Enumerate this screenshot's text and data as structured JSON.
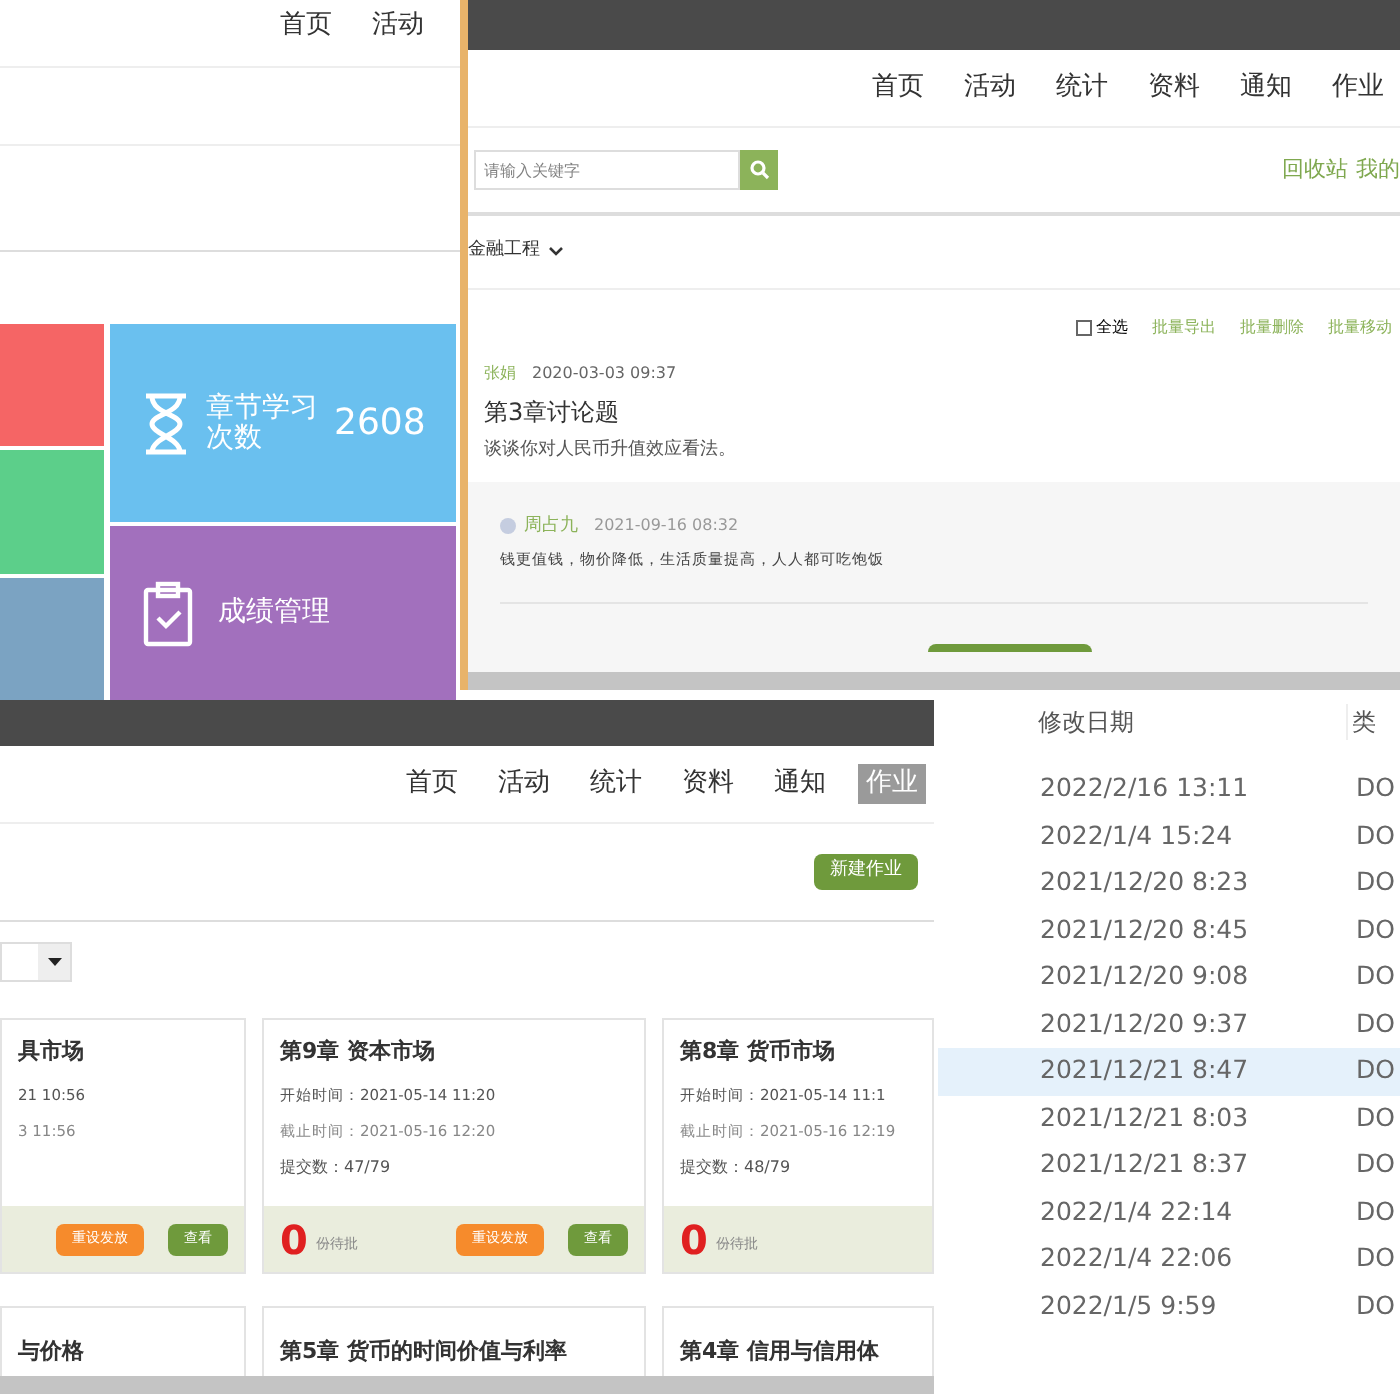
{
  "dashboard": {
    "nav": [
      {
        "label": "首页",
        "selected": false
      },
      {
        "label": "活动",
        "selected": false
      }
    ],
    "tiles": [
      {
        "kind": "blank",
        "color": "#f56565"
      },
      {
        "kind": "blank",
        "color": "#5ccf8a"
      },
      {
        "kind": "blank",
        "color": "#7ba3c2"
      },
      {
        "kind": "stat",
        "label": "章节学习",
        "label_2": "次数",
        "value": "2608",
        "color": "#6ac0ef"
      },
      {
        "kind": "link",
        "label": "成绩管理",
        "color": "#a270bd"
      }
    ]
  },
  "discussion": {
    "nav": [
      {
        "label": "首页",
        "selected": false
      },
      {
        "label": "活动",
        "selected": false
      },
      {
        "label": "统计",
        "selected": false
      },
      {
        "label": "资料",
        "selected": false
      },
      {
        "label": "通知",
        "selected": false
      },
      {
        "label": "作业",
        "selected": false
      }
    ],
    "search": {
      "placeholder": "请输入关键字"
    },
    "links": [
      "回收站",
      "我的"
    ],
    "course": "金融工程",
    "select_all": {
      "label": "全选",
      "checked": false
    },
    "actions": [
      "批量导出",
      "批量删除",
      "批量移动"
    ],
    "post": {
      "author": "张娟",
      "time": "2020-03-03 09:37",
      "title": "第3章讨论题",
      "body": "谈谈你对人民币升值效应看法。"
    },
    "reply": {
      "author": "周占九",
      "time": "2021-09-16 08:32",
      "body": "钱更值钱，物价降低，生活质量提高，人人都可吃饱饭"
    }
  },
  "homework": {
    "nav": [
      {
        "label": "首页",
        "selected": false
      },
      {
        "label": "活动",
        "selected": false
      },
      {
        "label": "统计",
        "selected": false
      },
      {
        "label": "资料",
        "selected": false
      },
      {
        "label": "通知",
        "selected": false
      },
      {
        "label": "作业",
        "selected": true
      }
    ],
    "new_button": "新建作业",
    "cards": [
      {
        "title": "具市场",
        "start": "21 10:56",
        "end": "3 11:56",
        "buttons": [
          "重设发放",
          "查看"
        ]
      },
      {
        "title": "第9章 资本市场",
        "start": "开始时间：2021-05-14 11:20",
        "end": "截止时间：2021-05-16 12:20",
        "submitted": "提交数：47/79",
        "pending": "0",
        "pending_label": "份待批",
        "buttons": [
          "重设发放",
          "查看"
        ]
      },
      {
        "title": "第8章 货币市场",
        "start": "开始时间：2021-05-14 11:1",
        "end": "截止时间：2021-05-16 12:19",
        "submitted": "提交数：48/79",
        "pending": "0",
        "pending_label": "份待批"
      }
    ],
    "more_titles": [
      "与价格",
      "第5章 货币的时间价值与利率",
      "第4章 信用与信用体"
    ]
  },
  "files": {
    "columns": [
      "修改日期",
      "类"
    ],
    "rows": [
      {
        "date": "2022/2/16 13:11",
        "type": "DO",
        "selected": false
      },
      {
        "date": "2022/1/4 15:24",
        "type": "DO",
        "selected": false
      },
      {
        "date": "2021/12/20 8:23",
        "type": "DO",
        "selected": false
      },
      {
        "date": "2021/12/20 8:45",
        "type": "DO",
        "selected": false
      },
      {
        "date": "2021/12/20 9:08",
        "type": "DO",
        "selected": false
      },
      {
        "date": "2021/12/20 9:37",
        "type": "DO",
        "selected": false
      },
      {
        "date": "2021/12/21 8:47",
        "type": "DO",
        "selected": true
      },
      {
        "date": "2021/12/21 8:03",
        "type": "DO",
        "selected": false
      },
      {
        "date": "2021/12/21 8:37",
        "type": "DO",
        "selected": false
      },
      {
        "date": "2022/1/4 22:14",
        "type": "DO",
        "selected": false
      },
      {
        "date": "2022/1/4 22:06",
        "type": "DO",
        "selected": false
      },
      {
        "date": "2022/1/5 9:59",
        "type": "DO",
        "selected": false
      }
    ]
  }
}
